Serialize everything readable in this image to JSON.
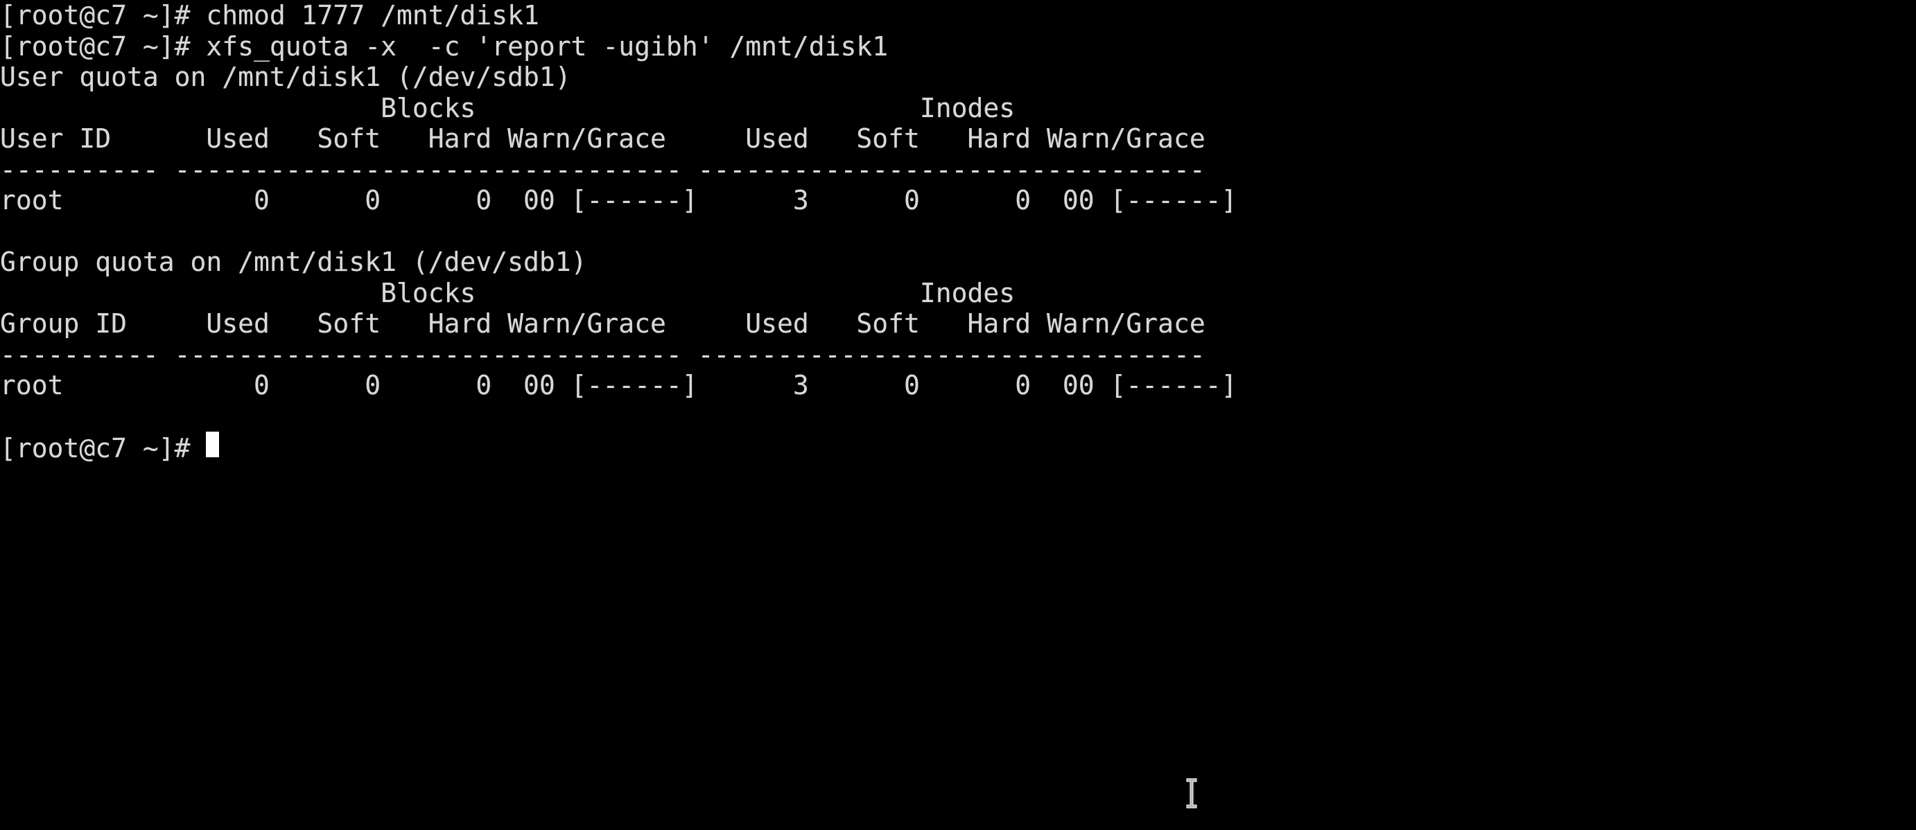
{
  "terminal": {
    "title": "root@c7 terminal",
    "colors": {
      "background": "#000000",
      "foreground": "#d8d8d8",
      "cursor": "#ffffff"
    },
    "prompt": "[root@c7 ~]#",
    "cursor_glyph": "block-cursor",
    "mouse_cursor": "text-ibeam-cursor",
    "lines": [
      "[root@c7 ~]# chmod 1777 /mnt/disk1",
      "[root@c7 ~]# xfs_quota -x  -c 'report -ugibh' /mnt/disk1",
      "User quota on /mnt/disk1 (/dev/sdb1)",
      "                        Blocks                            Inodes              ",
      "User ID      Used   Soft   Hard Warn/Grace     Used   Soft   Hard Warn/Grace",
      "---------- -------------------------------- --------------------------------",
      "root            0      0      0  00 [------]      3      0      0  00 [------]",
      "",
      "Group quota on /mnt/disk1 (/dev/sdb1)",
      "                        Blocks                            Inodes              ",
      "Group ID     Used   Soft   Hard Warn/Grace     Used   Soft   Hard Warn/Grace",
      "---------- -------------------------------- --------------------------------",
      "root            0      0      0  00 [------]      3      0      0  00 [------]",
      ""
    ],
    "final_prompt": "[root@c7 ~]# "
  },
  "commands": [
    {
      "prompt": "[root@c7 ~]#",
      "command": "chmod 1777 /mnt/disk1"
    },
    {
      "prompt": "[root@c7 ~]#",
      "command": "xfs_quota -x  -c 'report -ugibh' /mnt/disk1"
    }
  ],
  "report": {
    "user_section": {
      "heading": "User quota on /mnt/disk1 (/dev/sdb1)",
      "mountpoint": "/mnt/disk1",
      "device": "/dev/sdb1",
      "group_headers": [
        "Blocks",
        "Inodes"
      ],
      "columns": [
        "User ID",
        "Used",
        "Soft",
        "Hard",
        "Warn/Grace",
        "Used",
        "Soft",
        "Hard",
        "Warn/Grace"
      ],
      "separator": "---------- -------------------------------- --------------------------------",
      "rows": [
        {
          "id": "root",
          "blocks_used": "0",
          "blocks_soft": "0",
          "blocks_hard": "0",
          "blocks_warn": "00",
          "blocks_grace": "[------]",
          "inodes_used": "3",
          "inodes_soft": "0",
          "inodes_hard": "0",
          "inodes_warn": "00",
          "inodes_grace": "[------]"
        }
      ]
    },
    "group_section": {
      "heading": "Group quota on /mnt/disk1 (/dev/sdb1)",
      "mountpoint": "/mnt/disk1",
      "device": "/dev/sdb1",
      "group_headers": [
        "Blocks",
        "Inodes"
      ],
      "columns": [
        "Group ID",
        "Used",
        "Soft",
        "Hard",
        "Warn/Grace",
        "Used",
        "Soft",
        "Hard",
        "Warn/Grace"
      ],
      "separator": "---------- -------------------------------- --------------------------------",
      "rows": [
        {
          "id": "root",
          "blocks_used": "0",
          "blocks_soft": "0",
          "blocks_hard": "0",
          "blocks_warn": "00",
          "blocks_grace": "[------]",
          "inodes_used": "3",
          "inodes_soft": "0",
          "inodes_hard": "0",
          "inodes_warn": "00",
          "inodes_grace": "[------]"
        }
      ]
    }
  }
}
